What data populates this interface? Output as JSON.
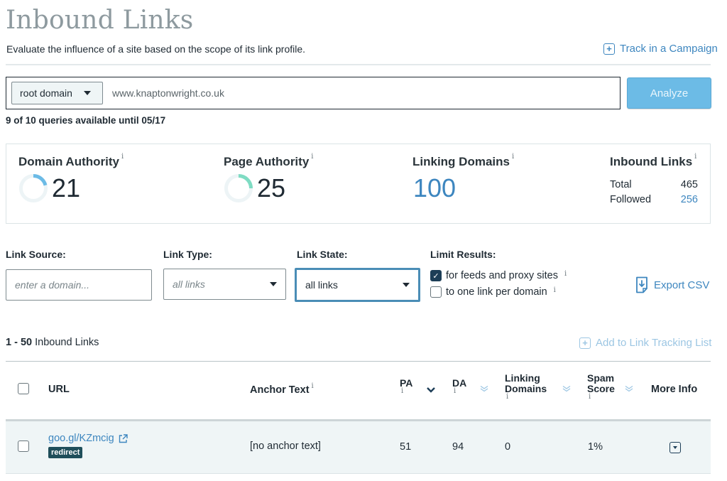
{
  "header": {
    "title": "Inbound Links",
    "subtitle": "Evaluate the influence of a site based on the scope of its link profile.",
    "track_campaign": "Track in a Campaign"
  },
  "search": {
    "scope": "root domain",
    "url_value": "www.knaptonwright.co.uk",
    "analyze_label": "Analyze",
    "quota": "9 of 10 queries available until 05/17"
  },
  "metrics": {
    "info_glyph": "i",
    "domain_authority": {
      "label": "Domain Authority",
      "value": "21",
      "score": 21,
      "color": "#6cbbe6"
    },
    "page_authority": {
      "label": "Page Authority",
      "value": "25",
      "score": 25,
      "color": "#7fdcc3"
    },
    "linking_domains": {
      "label": "Linking Domains",
      "value": "100"
    },
    "inbound_links": {
      "label": "Inbound Links",
      "total_label": "Total",
      "total_value": "465",
      "followed_label": "Followed",
      "followed_value": "256"
    }
  },
  "filters": {
    "link_source": {
      "label": "Link Source:",
      "placeholder": "enter a domain..."
    },
    "link_type": {
      "label": "Link Type:",
      "value": "all links"
    },
    "link_state": {
      "label": "Link State:",
      "value": "all links"
    },
    "limit_results": {
      "label": "Limit Results:",
      "options": [
        {
          "label": "for feeds and proxy sites",
          "checked": true
        },
        {
          "label": "to one link per domain",
          "checked": false
        }
      ]
    },
    "export_label": "Export CSV"
  },
  "results": {
    "range": "1 - 50",
    "range_label": "Inbound Links",
    "add_tracking": "Add to Link Tracking List",
    "columns": {
      "url": "URL",
      "anchor": "Anchor Text",
      "pa": "PA",
      "da": "DA",
      "ld_line1": "Linking",
      "ld_line2": "Domains",
      "spam_line1": "Spam",
      "spam_line2": "Score",
      "more": "More Info"
    },
    "rows": [
      {
        "url": "goo.gl/KZmcig",
        "badge": "redirect",
        "anchor": "[no anchor text]",
        "pa": "51",
        "da": "94",
        "linking_domains": "0",
        "spam_score": "1%"
      }
    ]
  }
}
